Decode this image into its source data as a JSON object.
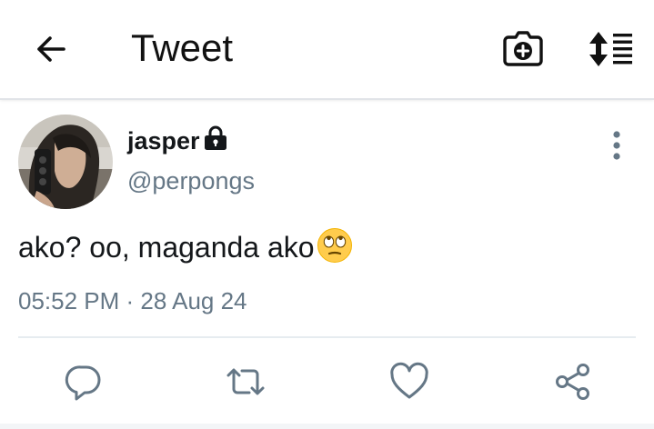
{
  "header": {
    "title": "Tweet",
    "back_icon": "arrow-left-icon",
    "camera_icon": "camera-plus-icon",
    "sort_icon": "sort-list-icon"
  },
  "tweet": {
    "author": {
      "name": "jasper",
      "handle": "@perpongs",
      "protected": true
    },
    "text": "ako? oo, maganda ako",
    "emoji": "face-with-rolling-eyes",
    "timestamp": "05:52 PM · 28 Aug 24"
  },
  "actions": [
    {
      "icon": "reply-icon"
    },
    {
      "icon": "retweet-icon"
    },
    {
      "icon": "like-icon"
    },
    {
      "icon": "share-icon"
    }
  ],
  "colors": {
    "text_primary": "#14171a",
    "text_secondary": "#657786",
    "action_icon": "#657786",
    "divider": "#e6ecf0"
  }
}
